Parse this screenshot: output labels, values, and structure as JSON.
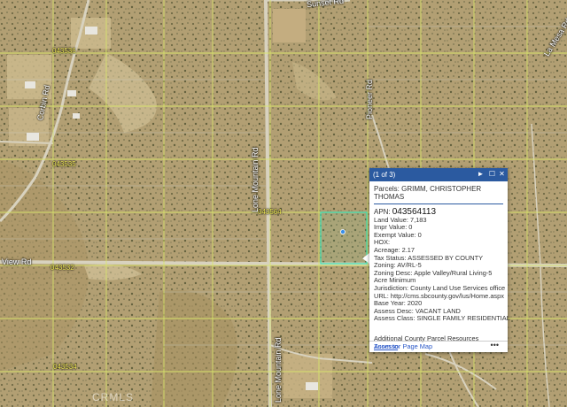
{
  "map": {
    "parcel_labels": [
      "043536",
      "043535",
      "043564",
      "043532",
      "043534"
    ],
    "road_labels": {
      "sunset_rd": "Sunset Rd",
      "corbin_rd": "Corbin Rd",
      "lone_mountain_rd_north": "Lone Mountain Rd",
      "lone_mountain_rd_south": "Lone Mountain Rd",
      "pioneer_rd": "Pioneer Rd",
      "view_rd": "View Rd",
      "la_mesa_rd": "La Mesa Rd"
    },
    "watermark": "CRMLS",
    "colors": {
      "parcel_line": "#d9e86a",
      "selected_parcel": "#3fe7b8",
      "road": "#d8d2bf",
      "popup_header": "#2b5aa0",
      "link": "#2a58c8"
    }
  },
  "popup": {
    "count": "(1 of 3)",
    "controls": {
      "next": "►",
      "maximize": "☐",
      "close": "✕"
    },
    "title": "Parcels: GRIMM, CHRISTOPHER THOMAS",
    "apn_label": "APN:",
    "apn_value": "043564113",
    "land_value": "Land Value: 7,183",
    "impr_value": "Impr Value: 0",
    "exempt_value": "Exempt Value: 0",
    "hox": "HOX:",
    "acreage": "Acreage: 2.17",
    "tax_status": "Tax Status: ASSESSED BY COUNTY",
    "zoning": "Zoning: AV/RL-5",
    "zoning_desc": "Zoning Desc: Apple Valley/Rural Living-5 Acre Minimum",
    "jurisdiction": "Jurisdiction: County Land Use Services office",
    "url_label": "URL:",
    "url_value": "http://cms.sbcounty.gov/lus/Home.aspx",
    "base_year": "Base Year: 2020",
    "assess_desc": "Assess Desc: VACANT LAND",
    "assess_class": "Assess Class: SINGLE FAMILY RESIDENTIAL",
    "resources_title": "Additional County Parcel Resources",
    "resources_link": "Assessor Page Map",
    "zoom_to": "Zoom to",
    "more": "•••"
  }
}
